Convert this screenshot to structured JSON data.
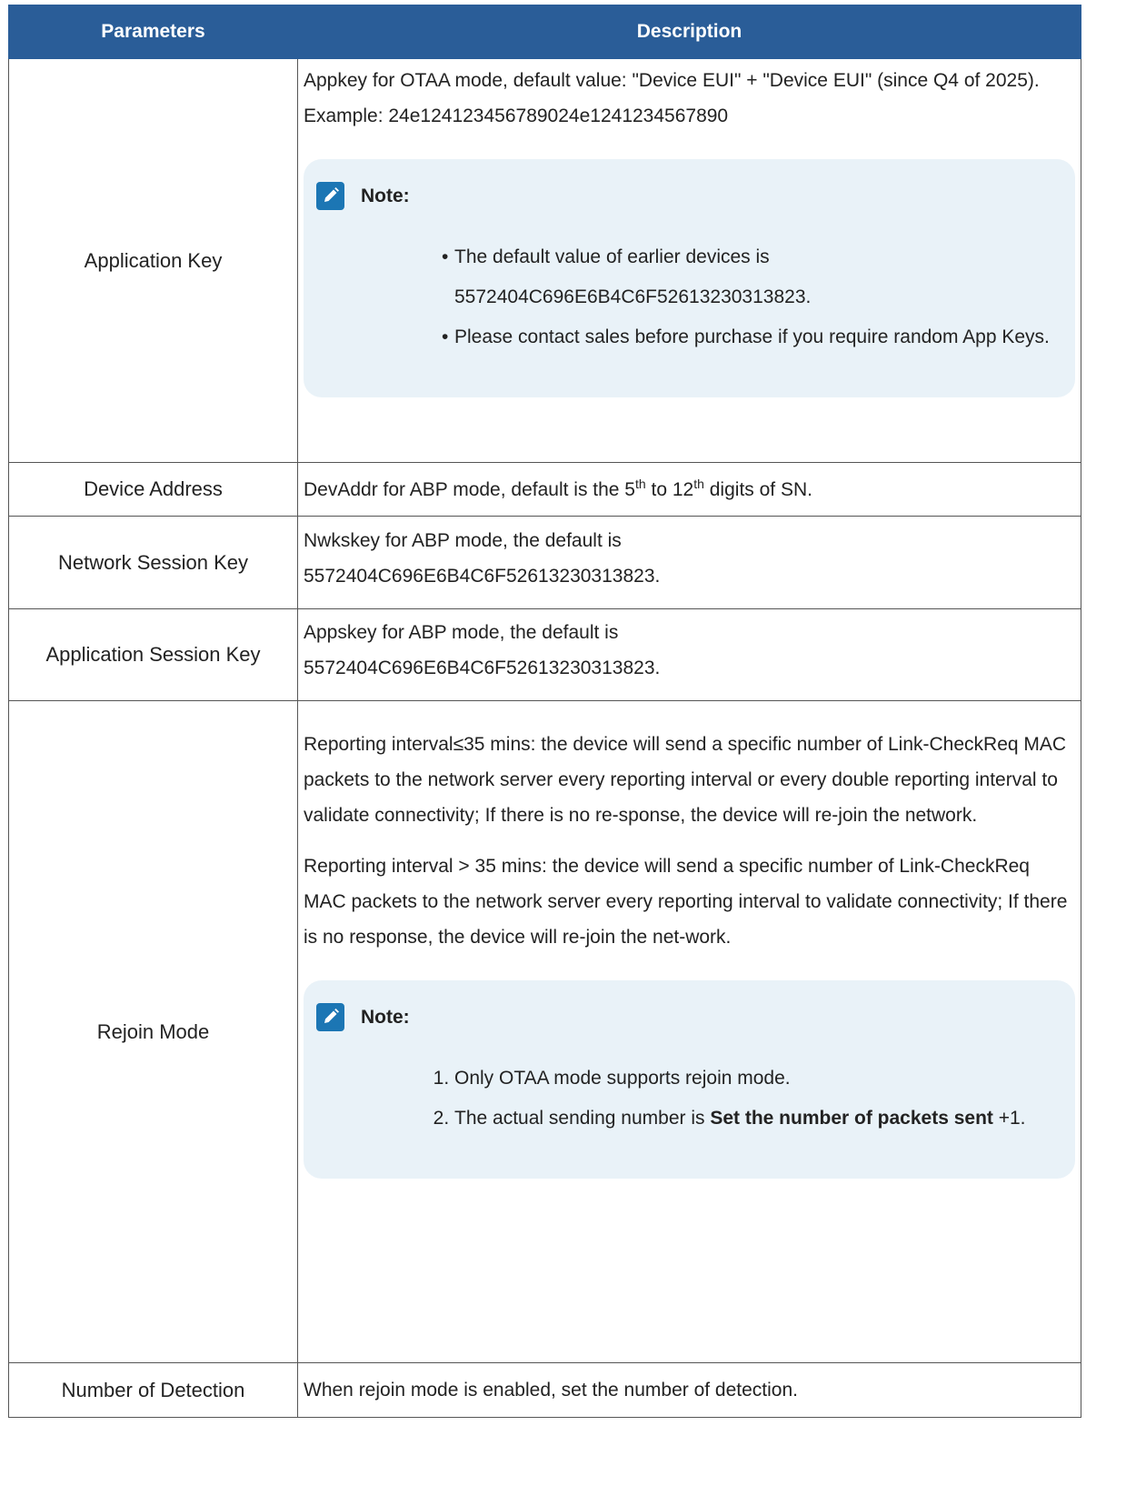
{
  "table": {
    "headers": [
      "Parameters",
      "Description"
    ],
    "rows": {
      "app_key": {
        "param": "Application Key",
        "desc": "Appkey for OTAA mode, default value: \"Device EUI\" + \"Device EUI\" (since Q4 of 2025). Example: 24e124123456789024e1241234567890",
        "note_title": "Note:",
        "note_items": [
          "The default value of earlier devices is 5572404C696E6B4C6F52613230313823.",
          "Please contact sales before purchase if you require random App Keys."
        ]
      },
      "dev_addr": {
        "param": "Device Address",
        "desc_before": "DevAddr for ABP mode, default is the 5",
        "sup1": "th",
        "desc_mid": " to 12",
        "sup2": "th",
        "desc_after": " digits of SN."
      },
      "nwk_skey": {
        "param": "Network Session Key",
        "desc": "Nwkskey for ABP mode, the default is 5572404C696E6B4C6F52613230313823."
      },
      "app_skey": {
        "param": "Application Session Key",
        "desc": "Appskey for ABP mode, the default is 5572404C696E6B4C6F52613230313823."
      },
      "rejoin": {
        "param": "Rejoin Mode",
        "desc_p1": "Reporting interval≤35 mins: the device will send a specific number of Link-CheckReq MAC packets to the network server every reporting interval or every double reporting interval to validate connectivity; If there is no re-sponse, the device will re-join the network.",
        "desc_p2": "Reporting interval > 35 mins: the device will send a specific number of Link-CheckReq MAC packets to the network server every reporting interval to validate connectivity; If there is no response, the device will re-join the net-work.",
        "note_title": "Note:",
        "note_item1": "Only OTAA mode supports rejoin mode.",
        "note_item2_before": "The actual sending number is ",
        "note_item2_bold": "Set the number of packets sent",
        "note_item2_after": " +1."
      },
      "detection": {
        "param": "Number of Detection",
        "desc": "When rejoin mode is enabled, set the number of detection."
      }
    }
  },
  "icons": {
    "note": "pencil-note-icon"
  },
  "colors": {
    "header_bg": "#2a5d98",
    "note_bg": "#e9f2f8",
    "note_icon": "#1c76b4"
  }
}
